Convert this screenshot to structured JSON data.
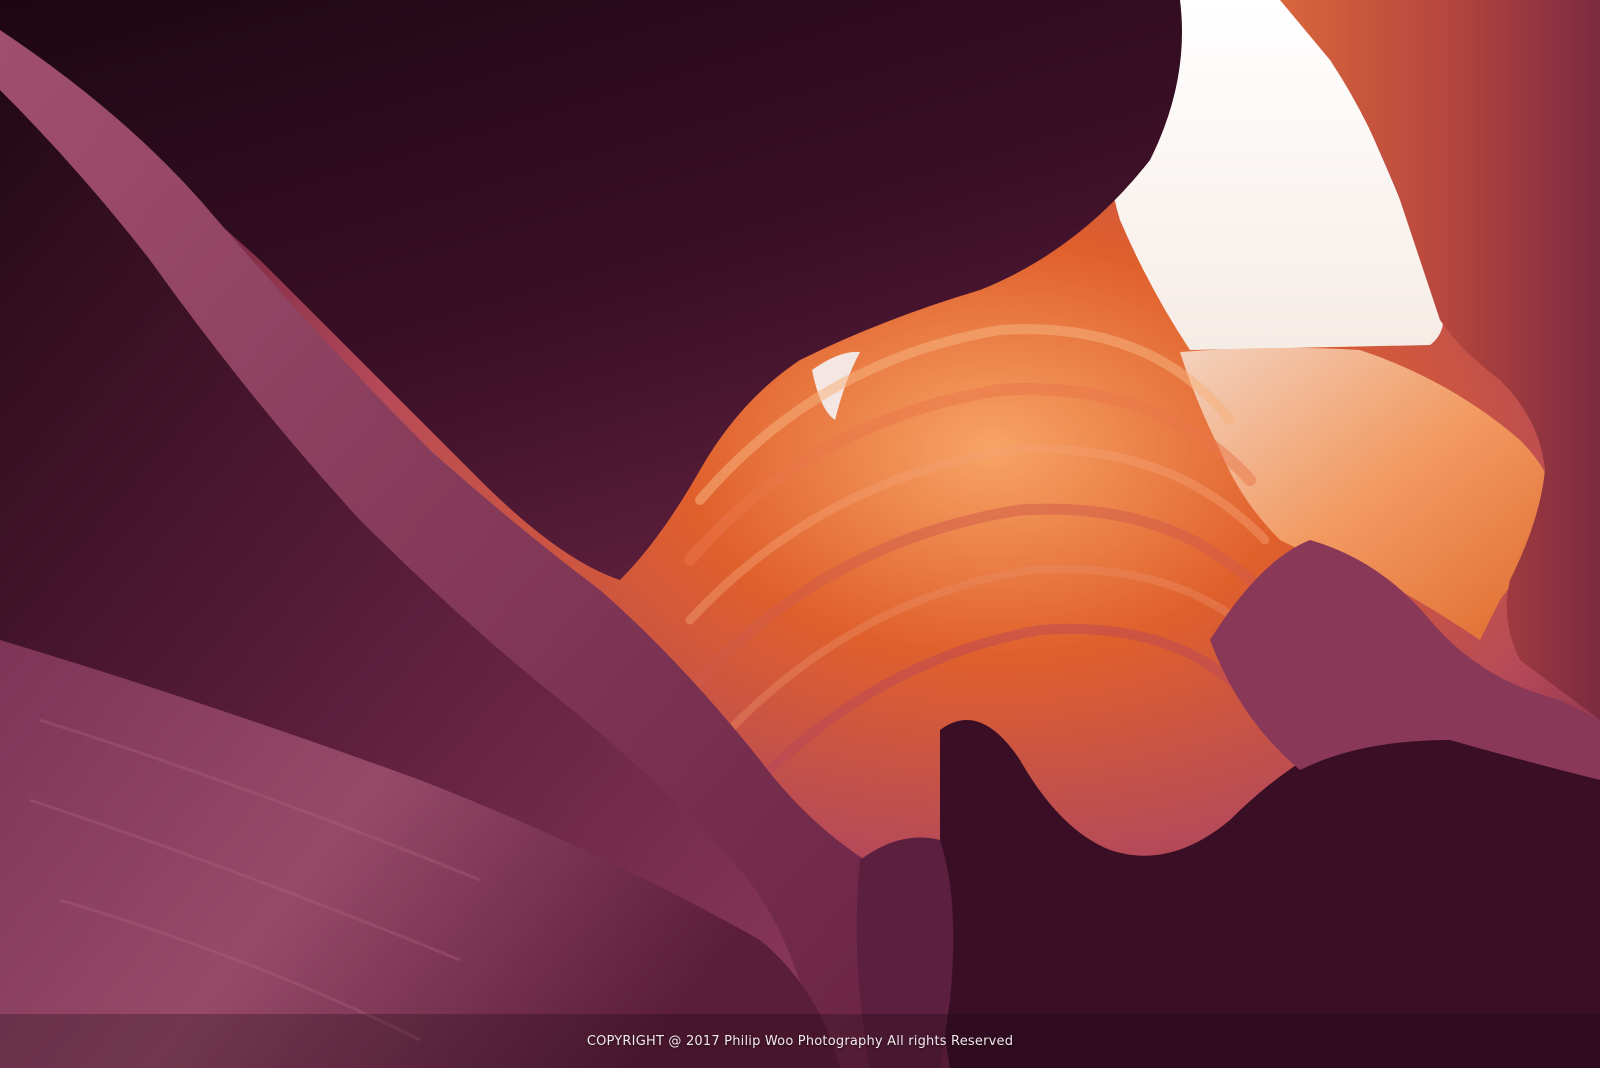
{
  "photo": {
    "colors": {
      "sky": "#fbf6f4",
      "shadow": "#1a0710",
      "rock_dark": "#3d0f26",
      "rock_purple": "#7a2a4c",
      "rock_magenta": "#a24c68",
      "rock_orange": "#e0602c",
      "rock_glow": "#f7a466"
    }
  },
  "watermark": {
    "text": "COPYRIGHT @ 2017 Philip Woo Photography  All rights Reserved"
  }
}
